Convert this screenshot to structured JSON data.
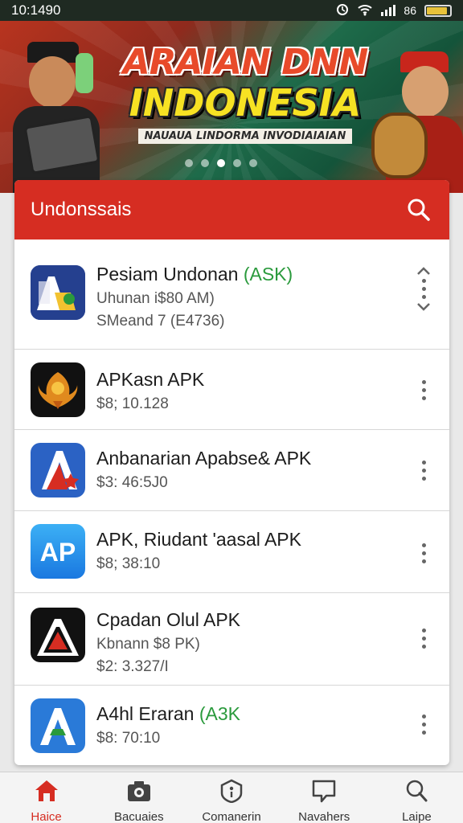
{
  "status_bar": {
    "time": "10:1490",
    "carrier": "86",
    "battery_level": 0.9
  },
  "banner": {
    "title_line1": "ARAIAN DNN",
    "title_line2": "INDONESIA",
    "subtitle": "NAUAUA LINDORMA INVODIAIAIAN",
    "slides": 5,
    "active_slide": 2
  },
  "card": {
    "title": "Undonssais"
  },
  "apps": [
    {
      "name": "Pesiam Undonan",
      "tag": "(ASK)",
      "line2": "Uhunan i$80 AM)",
      "line3": "SMeand 7 (E4736)",
      "icon": "na-logo-icon"
    },
    {
      "name": "APKasn APK",
      "tag": "",
      "line2": "$8; 10.128",
      "line3": "",
      "icon": "garuda-icon"
    },
    {
      "name": "Anbanarian Apabse& APK",
      "tag": "",
      "line2": "$3: 46:5J0",
      "line3": "",
      "icon": "star-a-icon"
    },
    {
      "name": "APK, Riudant 'aasal APK",
      "tag": "",
      "line2": "$8; 38:10",
      "line3": "",
      "icon": "ap-icon"
    },
    {
      "name": "Cpadan Olul APK",
      "tag": "",
      "line2": "Kbnann $8 PK)",
      "line3": "$2: 3.327/I",
      "icon": "triangle-icon"
    },
    {
      "name": "A4hl Eraran",
      "tag": "(A3K",
      "line2": "$8: 70:10",
      "line3": "",
      "icon": "blue-a-icon"
    }
  ],
  "nav": [
    {
      "label": "Haice",
      "icon": "home-icon",
      "active": true
    },
    {
      "label": "Bacuaies",
      "icon": "camera-icon",
      "active": false
    },
    {
      "label": "Comanerin",
      "icon": "shield-icon",
      "active": false
    },
    {
      "label": "Navahers",
      "icon": "chat-icon",
      "active": false
    },
    {
      "label": "Laipe",
      "icon": "person-icon",
      "active": false
    }
  ],
  "colors": {
    "accent": "#d62d22",
    "green": "#2a9a3c"
  }
}
